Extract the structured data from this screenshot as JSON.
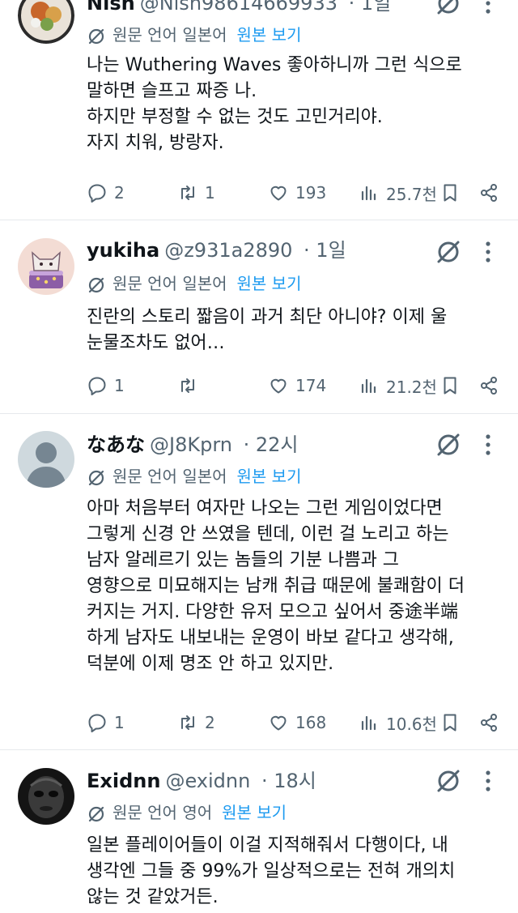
{
  "tweets": [
    {
      "name": "Nish",
      "handle": "@Nish98614669933",
      "time": "· 1일",
      "translation": {
        "label": "원문 언어 일본어",
        "link": "원본 보기"
      },
      "lines": [
        "나는 Wuthering Waves 좋아하니까 그런 식으로",
        "말하면 슬프고 짜증 나.",
        "하지만 부정할 수 없는 것도 고민거리야.",
        "자지 치워, 방랑자."
      ],
      "replies": "2",
      "reposts": "1",
      "likes": "193",
      "views": "25.7천"
    },
    {
      "name": "yukiha",
      "handle": "@z931a2890",
      "time": "· 1일",
      "translation": {
        "label": "원문 언어 일본어",
        "link": "원본 보기"
      },
      "lines": [
        "진란의 스토리 짧음이 과거 최단 아니야? 이제 울",
        "눈물조차도 없어…"
      ],
      "replies": "1",
      "reposts": "",
      "likes": "174",
      "views": "21.2천"
    },
    {
      "name": "なあな",
      "handle": "@J8Kprn",
      "time": "· 22시",
      "translation": {
        "label": "원문 언어 일본어",
        "link": "원본 보기"
      },
      "lines": [
        "아마 처음부터 여자만 나오는 그런 게임이었다면",
        "그렇게 신경 안 쓰였을 텐데, 이런 걸 노리고 하는",
        "남자 알레르기 있는 놈들의 기분 나쁨과 그",
        "영향으로 미묘해지는 남캐 취급 때문에 불쾌함이 더",
        "커지는 거지. 다양한 유저 모으고 싶어서 중途半端",
        "하게 남자도 내보내는 운영이 바보 같다고 생각해,",
        "덕분에 이제 명조 안 하고 있지만."
      ],
      "replies": "1",
      "reposts": "2",
      "likes": "168",
      "views": "10.6천"
    },
    {
      "name": "Exidnn",
      "handle": "@exidnn",
      "time": "· 18시",
      "translation": {
        "label": "원문 언어 영어",
        "link": "원본 보기"
      },
      "lines": [
        "일본 플레이어들이 이걸 지적해줘서 다행이다, 내",
        "생각엔 그들 중 99%가 일상적으로는 전혀 개의치",
        "않는 것 같았거든."
      ]
    }
  ]
}
